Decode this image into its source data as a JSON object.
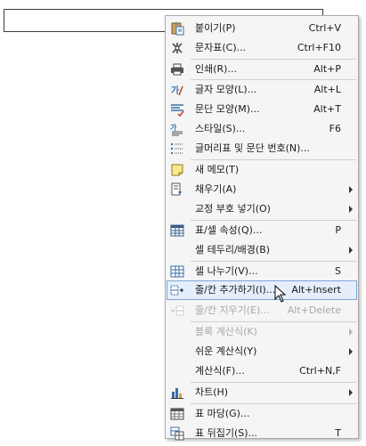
{
  "menu": {
    "items": [
      {
        "label": "붙이기(P)",
        "shortcut": "Ctrl+V",
        "icon": "paste-icon"
      },
      {
        "label": "문자표(C)...",
        "shortcut": "Ctrl+F10",
        "icon": "symbol-icon"
      },
      {
        "label": "인쇄(R)...",
        "shortcut": "Alt+P",
        "icon": "printer-icon"
      },
      {
        "label": "글자 모양(L)...",
        "shortcut": "Alt+L",
        "icon": "char-shape-icon"
      },
      {
        "label": "문단 모양(M)...",
        "shortcut": "Alt+T",
        "icon": "paragraph-shape-icon"
      },
      {
        "label": "스타일(S)...",
        "shortcut": "F6",
        "icon": "style-icon"
      },
      {
        "label": "글머리표 및 문단 번호(N)...",
        "shortcut": "",
        "icon": "bullet-list-icon"
      },
      {
        "label": "새 메모(T)",
        "shortcut": "",
        "icon": "memo-icon"
      },
      {
        "label": "채우기(A)",
        "shortcut": "",
        "icon": "fill-icon",
        "submenu": true
      },
      {
        "label": "교정 부호 넣기(O)",
        "shortcut": "",
        "icon": "",
        "submenu": true
      },
      {
        "label": "표/셀 속성(Q)...",
        "shortcut": "P",
        "icon": "table-props-icon"
      },
      {
        "label": "셀 테두리/배경(B)",
        "shortcut": "",
        "icon": "",
        "submenu": true
      },
      {
        "label": "셀 나누기(V)...",
        "shortcut": "S",
        "icon": "split-cell-icon"
      },
      {
        "label": "줄/칸 추가하기(I)...",
        "shortcut": "Alt+Insert",
        "icon": "insert-row-col-icon",
        "highlighted": true
      },
      {
        "label": "줄/칸 지우기(E)...",
        "shortcut": "Alt+Delete",
        "icon": "delete-row-col-icon",
        "disabled": true
      },
      {
        "label": "블록 계산식(K)",
        "shortcut": "",
        "icon": "",
        "submenu": true,
        "disabled": true
      },
      {
        "label": "쉬운 계산식(Y)",
        "shortcut": "",
        "icon": "",
        "submenu": true
      },
      {
        "label": "계산식(F)...",
        "shortcut": "Ctrl+N,F",
        "icon": ""
      },
      {
        "label": "차트(H)",
        "shortcut": "",
        "icon": "chart-icon",
        "submenu": true
      },
      {
        "label": "표 마당(G)...",
        "shortcut": "",
        "icon": "table-gallery-icon"
      },
      {
        "label": "표 뒤집기(S)...",
        "shortcut": "T",
        "icon": "table-flip-icon"
      }
    ]
  }
}
